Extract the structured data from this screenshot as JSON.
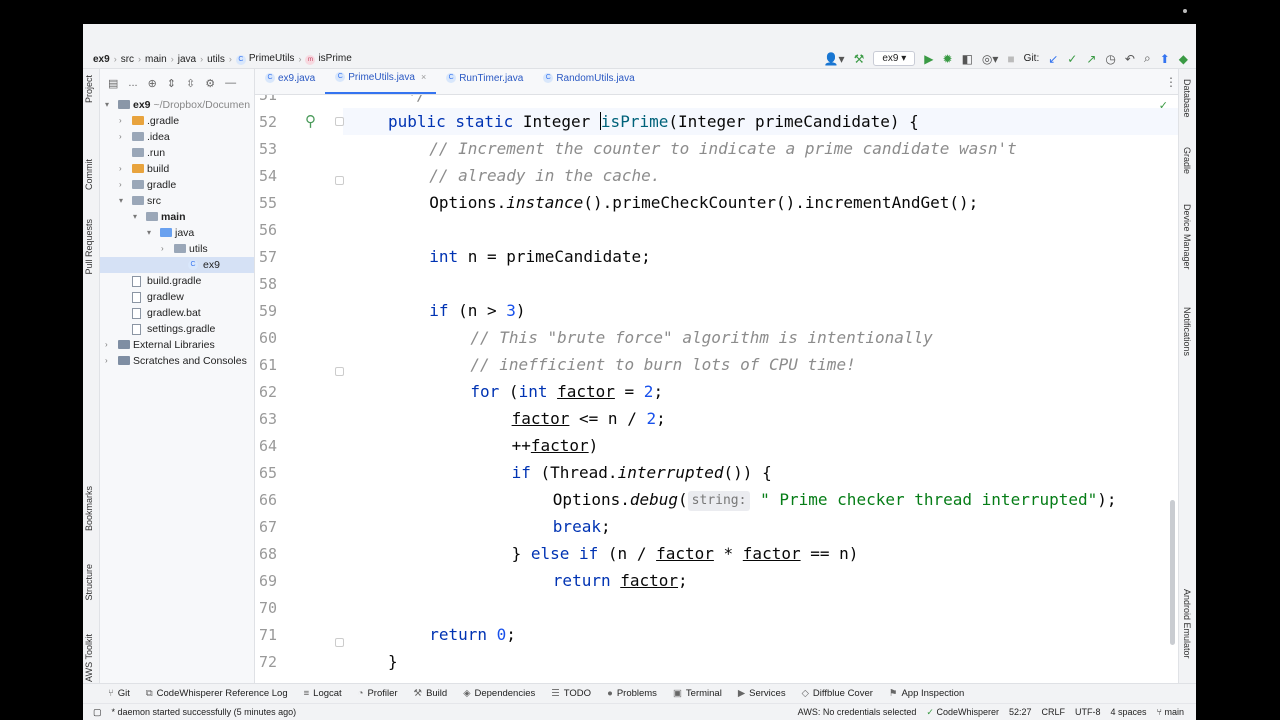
{
  "breadcrumbs": [
    "ex9",
    "src",
    "main",
    "java",
    "utils",
    "PrimeUtils",
    "isPrime"
  ],
  "toolbar": {
    "run_config": "ex9",
    "git_label": "Git:"
  },
  "left_stripe": [
    "Project",
    "Commit",
    "Pull Requests",
    "Bookmarks",
    "Structure",
    "AWS Toolkit"
  ],
  "right_stripe": [
    "Database",
    "Gradle",
    "Device Manager",
    "Notifications",
    "Android Emulator"
  ],
  "project_header": "...",
  "tree": [
    {
      "label": "ex9",
      "suffix": "~/Dropbox/Documen",
      "indent": 0,
      "arrow": "▾",
      "kind": "module",
      "bold": true
    },
    {
      "label": ".gradle",
      "indent": 1,
      "arrow": "›",
      "kind": "orange"
    },
    {
      "label": ".idea",
      "indent": 1,
      "arrow": "›",
      "kind": "grey"
    },
    {
      "label": ".run",
      "indent": 1,
      "arrow": "",
      "kind": "grey"
    },
    {
      "label": "build",
      "indent": 1,
      "arrow": "›",
      "kind": "orange"
    },
    {
      "label": "gradle",
      "indent": 1,
      "arrow": "›",
      "kind": "grey"
    },
    {
      "label": "src",
      "indent": 1,
      "arrow": "▾",
      "kind": "grey"
    },
    {
      "label": "main",
      "indent": 2,
      "arrow": "▾",
      "kind": "grey",
      "bold": true
    },
    {
      "label": "java",
      "indent": 3,
      "arrow": "▾",
      "kind": "blue"
    },
    {
      "label": "utils",
      "indent": 4,
      "arrow": "›",
      "kind": "grey"
    },
    {
      "label": "ex9",
      "indent": 5,
      "arrow": "",
      "kind": "class",
      "selected": true
    },
    {
      "label": "build.gradle",
      "indent": 1,
      "arrow": "",
      "kind": "file"
    },
    {
      "label": "gradlew",
      "indent": 1,
      "arrow": "",
      "kind": "file"
    },
    {
      "label": "gradlew.bat",
      "indent": 1,
      "arrow": "",
      "kind": "file"
    },
    {
      "label": "settings.gradle",
      "indent": 1,
      "arrow": "",
      "kind": "file"
    },
    {
      "label": "External Libraries",
      "indent": 0,
      "arrow": "›",
      "kind": "lib"
    },
    {
      "label": "Scratches and Consoles",
      "indent": 0,
      "arrow": "›",
      "kind": "lib"
    }
  ],
  "tabs": [
    {
      "label": "ex9.java",
      "icon": "C",
      "active": false,
      "closable": false
    },
    {
      "label": "PrimeUtils.java",
      "icon": "C",
      "active": true,
      "closable": true
    },
    {
      "label": "RunTimer.java",
      "icon": "C",
      "active": false,
      "closable": false
    },
    {
      "label": "RandomUtils.java",
      "icon": "C",
      "active": false,
      "closable": false
    }
  ],
  "code_lines": [
    {
      "n": "51",
      "indent": 0,
      "tokens": [
        [
          "cm",
          "  */"
        ]
      ]
    },
    {
      "n": "52",
      "indent": 0,
      "tokens": [
        [
          "kw",
          "public static "
        ],
        [
          "",
          "Integer "
        ],
        [
          "caret",
          ""
        ],
        [
          "fn",
          "isPrime"
        ],
        [
          "",
          "(Integer primeCandidate) {"
        ]
      ]
    },
    {
      "n": "53",
      "indent": 1,
      "tokens": [
        [
          "cm",
          "// Increment the counter to indicate a prime candidate wasn't"
        ]
      ]
    },
    {
      "n": "54",
      "indent": 1,
      "tokens": [
        [
          "cm",
          "// already in the cache."
        ]
      ]
    },
    {
      "n": "55",
      "indent": 1,
      "tokens": [
        [
          "",
          "Options."
        ],
        [
          "it",
          "instance"
        ],
        [
          "",
          "().primeCheckCounter().incrementAndGet();"
        ]
      ]
    },
    {
      "n": "56",
      "indent": 0,
      "tokens": []
    },
    {
      "n": "57",
      "indent": 1,
      "tokens": [
        [
          "kw",
          "int "
        ],
        [
          "",
          "n = primeCandidate;"
        ]
      ]
    },
    {
      "n": "58",
      "indent": 0,
      "tokens": []
    },
    {
      "n": "59",
      "indent": 1,
      "tokens": [
        [
          "kw",
          "if "
        ],
        [
          "",
          "(n > "
        ],
        [
          "num",
          "3"
        ],
        [
          "",
          ")"
        ]
      ]
    },
    {
      "n": "60",
      "indent": 2,
      "tokens": [
        [
          "cm",
          "// This \"brute force\" algorithm is intentionally"
        ]
      ]
    },
    {
      "n": "61",
      "indent": 2,
      "tokens": [
        [
          "cm",
          "// inefficient to burn lots of CPU time!"
        ]
      ]
    },
    {
      "n": "62",
      "indent": 2,
      "tokens": [
        [
          "kw",
          "for "
        ],
        [
          "",
          "("
        ],
        [
          "kw",
          "int "
        ],
        [
          "ul",
          "factor"
        ],
        [
          "",
          " = "
        ],
        [
          "num",
          "2"
        ],
        [
          "",
          ";"
        ]
      ]
    },
    {
      "n": "63",
      "indent": 3,
      "tokens": [
        [
          "ul",
          "factor"
        ],
        [
          "",
          " <= n / "
        ],
        [
          "num",
          "2"
        ],
        [
          "",
          ";"
        ]
      ]
    },
    {
      "n": "64",
      "indent": 3,
      "tokens": [
        [
          "",
          "++"
        ],
        [
          "ul",
          "factor"
        ],
        [
          "",
          ")"
        ]
      ]
    },
    {
      "n": "65",
      "indent": 3,
      "tokens": [
        [
          "kw",
          "if "
        ],
        [
          "",
          "(Thread."
        ],
        [
          "it",
          "interrupted"
        ],
        [
          "",
          "()) {"
        ]
      ]
    },
    {
      "n": "66",
      "indent": 4,
      "tokens": [
        [
          "",
          "Options."
        ],
        [
          "it",
          "debug"
        ],
        [
          "",
          "("
        ],
        [
          "hint",
          "string:"
        ],
        [
          "str",
          "\" Prime checker thread interrupted\""
        ],
        [
          "",
          ");"
        ]
      ]
    },
    {
      "n": "67",
      "indent": 4,
      "tokens": [
        [
          "kw",
          "break"
        ],
        [
          "",
          ";"
        ]
      ]
    },
    {
      "n": "68",
      "indent": 3,
      "tokens": [
        [
          "",
          "} "
        ],
        [
          "kw",
          "else if "
        ],
        [
          "",
          "(n / "
        ],
        [
          "ul",
          "factor"
        ],
        [
          "",
          " * "
        ],
        [
          "ul",
          "factor"
        ],
        [
          "",
          " == n)"
        ]
      ]
    },
    {
      "n": "69",
      "indent": 4,
      "tokens": [
        [
          "kw",
          "return "
        ],
        [
          "ul",
          "factor"
        ],
        [
          "",
          ";"
        ]
      ]
    },
    {
      "n": "70",
      "indent": 0,
      "tokens": []
    },
    {
      "n": "71",
      "indent": 1,
      "tokens": [
        [
          "kw",
          "return "
        ],
        [
          "num",
          "0"
        ],
        [
          "",
          ";"
        ]
      ]
    },
    {
      "n": "72",
      "indent": 0,
      "tokens": [
        [
          "",
          "}"
        ]
      ]
    }
  ],
  "bottom_tools": [
    {
      "label": "Git",
      "icon": "⑂"
    },
    {
      "label": "CodeWhisperer Reference Log",
      "icon": "⧉"
    },
    {
      "label": "Logcat",
      "icon": "≡"
    },
    {
      "label": "Profiler",
      "icon": "◔"
    },
    {
      "label": "Build",
      "icon": "⚒"
    },
    {
      "label": "Dependencies",
      "icon": "◈"
    },
    {
      "label": "TODO",
      "icon": "☰"
    },
    {
      "label": "Problems",
      "icon": "●"
    },
    {
      "label": "Terminal",
      "icon": "▣"
    },
    {
      "label": "Services",
      "icon": "▶"
    },
    {
      "label": "Diffblue Cover",
      "icon": "◇"
    },
    {
      "label": "App Inspection",
      "icon": "⚑"
    }
  ],
  "status": {
    "message": "* daemon started successfully (5 minutes ago)",
    "aws": "AWS: No credentials selected",
    "codewhisperer": "CodeWhisperer",
    "position": "52:27",
    "line_sep": "CRLF",
    "encoding": "UTF-8",
    "indent": "4 spaces",
    "branch": "main"
  }
}
